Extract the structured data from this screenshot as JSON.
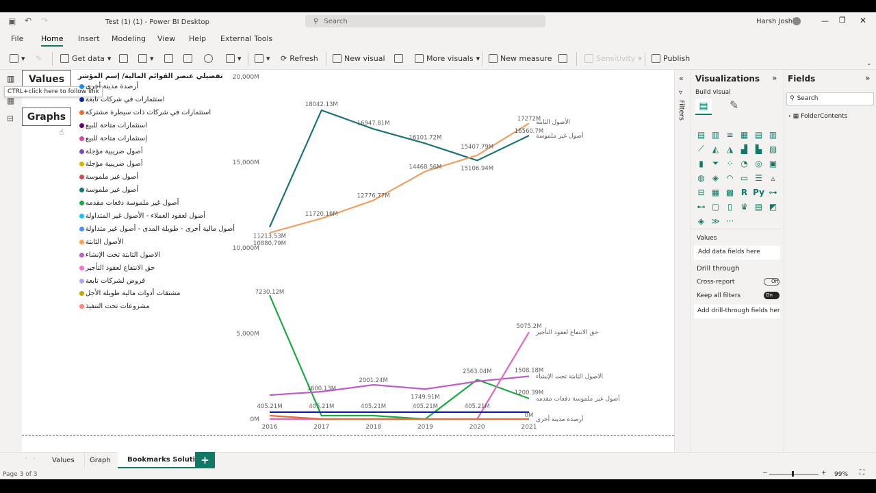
{
  "window": {
    "title": "Test (1) (1) - Power BI Desktop",
    "search_placeholder": "Search",
    "user": "Harsh Joshi"
  },
  "menu": [
    "File",
    "Home",
    "Insert",
    "Modeling",
    "View",
    "Help",
    "External Tools"
  ],
  "ribbon": {
    "get_data": "Get data",
    "refresh": "Refresh",
    "new_visual": "New visual",
    "more_visuals": "More visuals",
    "new_measure": "New measure",
    "sensitivity": "Sensitivity",
    "publish": "Publish"
  },
  "bookmarks": {
    "values": "Values",
    "graphs": "Graphs",
    "tooltip": "CTRL+click here to follow link"
  },
  "legend": {
    "title": "تفصيلي عنصر القوائم المالية/ إسم المؤشر",
    "items": [
      {
        "label": "أرصدة مدينة أخرى",
        "color": "#118dff"
      },
      {
        "label": "استثمارات في شركات تابعة",
        "color": "#12239e"
      },
      {
        "label": "استثمارات في شركات ذات سيطرة مشتركة",
        "color": "#e66c37"
      },
      {
        "label": "استثمارات متاحة للبيع",
        "color": "#6b007b"
      },
      {
        "label": "إستثمارات متاحة للبيع",
        "color": "#e044a7"
      },
      {
        "label": "أصول ضريبية مؤجلة",
        "color": "#744ec2"
      },
      {
        "label": "أصول ضريبية مؤجلة",
        "color": "#d9b300"
      },
      {
        "label": "أصول غير ملموسة",
        "color": "#d64550"
      },
      {
        "label": "أصول غير ملموسة",
        "color": "#197278"
      },
      {
        "label": "أصول غير ملموسة دفعات مقدمه",
        "color": "#1aab40"
      },
      {
        "label": "أصول لعقود العملاء - الأصول غير المتداولة",
        "color": "#15c6f4"
      },
      {
        "label": "أصول مالية أخرى - طويلة المدى - أصول غير متداولة",
        "color": "#4092ff"
      },
      {
        "label": "الأصول الثابتة",
        "color": "#ffa058"
      },
      {
        "label": "الاصول الثابتة تحت الإنشاء",
        "color": "#be5dc9"
      },
      {
        "label": "حق الانتفاع لعقود التأجير",
        "color": "#f472d0"
      },
      {
        "label": "قروض لشركات تابعة",
        "color": "#b5a1ff"
      },
      {
        "label": "مشتقات أدوات مالية طويلة الأجل",
        "color": "#c4a200"
      },
      {
        "label": "مشروعات تحت التنفيذ",
        "color": "#ff8080"
      }
    ]
  },
  "chart_data": {
    "type": "line",
    "x": [
      "2016",
      "2017",
      "2018",
      "2019",
      "2020",
      "2021"
    ],
    "ylim": [
      0,
      20000
    ],
    "yticks": [
      "0M",
      "5,000M",
      "10,000M",
      "15,000M",
      "20,000M"
    ],
    "series": [
      {
        "name": "أصول غير ملموسة",
        "color": "#197278",
        "values": [
          11213.53,
          18042.13,
          16947.81,
          16101.72,
          15106.94,
          16560
        ]
      },
      {
        "name": "الأصول الثابتة",
        "color": "#f0a060",
        "values": [
          10880.79,
          11720.16,
          12776.77,
          14468.56,
          15407.79,
          17272
        ]
      },
      {
        "name": "أصول غير ملموسة دفعات مقدمه",
        "color": "#1aab40",
        "values": [
          7230.12,
          200,
          200,
          0,
          2300,
          1200.39
        ]
      },
      {
        "name": "الاصول الثابتة تحت الإنشاء",
        "color": "#be5dc9",
        "values": [
          1400,
          1600,
          2000,
          1750,
          2200,
          2500
        ]
      },
      {
        "name": "حق الانتفاع لعقود التأجير",
        "color": "#e066c0",
        "values": [
          0,
          0,
          0,
          0,
          0,
          5075.2
        ]
      },
      {
        "name": "أرصدة مدينة أخرى",
        "color": "#12239e",
        "values": [
          405.21,
          405.21,
          405.21,
          405.21,
          405.21,
          405.21
        ]
      },
      {
        "name": "مشروعات تحت التنفيذ",
        "color": "#e66c37",
        "values": [
          200,
          0,
          0,
          0,
          0,
          0
        ]
      }
    ],
    "labels": [
      {
        "t": "18042.13M",
        "x": 2017,
        "y": 18042.13,
        "dy": -6
      },
      {
        "t": "16947.81M",
        "x": 2018,
        "y": 16947.81,
        "dy": -6
      },
      {
        "t": "16101.72M",
        "x": 2019,
        "y": 16101.72,
        "dy": -6
      },
      {
        "t": "15407.79M",
        "x": 2020,
        "y": 15407.79,
        "dy": -10
      },
      {
        "t": "15106.94M",
        "x": 2020,
        "y": 15106.94,
        "dy": 14
      },
      {
        "t": "17272M",
        "x": 2021,
        "y": 17272,
        "dy": -4
      },
      {
        "t": "16560.7M",
        "x": 2021,
        "y": 16560,
        "dy": -4
      },
      {
        "t": "11213.53M",
        "x": 2016,
        "y": 11213.53,
        "dy": 16
      },
      {
        "t": "10880.79M",
        "x": 2016,
        "y": 10880.79,
        "dy": 18
      },
      {
        "t": "11720.16M",
        "x": 2017,
        "y": 11720.16,
        "dy": -4
      },
      {
        "t": "12776.77M",
        "x": 2018,
        "y": 12776.77,
        "dy": -4
      },
      {
        "t": "14468.56M",
        "x": 2019,
        "y": 14468.56,
        "dy": -4
      },
      {
        "t": "7230.12M",
        "x": 2016,
        "y": 7230.12,
        "dy": -2
      },
      {
        "t": "5075.2M",
        "x": 2021,
        "y": 5075.2,
        "dy": -6
      },
      {
        "t": "2001.24M",
        "x": 2018,
        "y": 2000,
        "dy": -4
      },
      {
        "t": "1600.13M",
        "x": 2017,
        "y": 1600,
        "dy": -2
      },
      {
        "t": "2563.04M",
        "x": 2020,
        "y": 2200,
        "dy": -12
      },
      {
        "t": "1508.18M",
        "x": 2021,
        "y": 2500,
        "dy": -6
      },
      {
        "t": "1749.91M",
        "x": 2019,
        "y": 1750,
        "dy": 14
      },
      {
        "t": "1200.39M",
        "x": 2021,
        "y": 1200.39,
        "dy": -6
      },
      {
        "t": "405.21M",
        "x": 2016,
        "y": 405.21,
        "dy": -6
      },
      {
        "t": "405.21M",
        "x": 2017,
        "y": 405.21,
        "dy": -6
      },
      {
        "t": "405.21M",
        "x": 2018,
        "y": 405.21,
        "dy": -6
      },
      {
        "t": "405.21M",
        "x": 2019,
        "y": 405.21,
        "dy": -6
      },
      {
        "t": "405.21M",
        "x": 2020,
        "y": 405.21,
        "dy": -6
      },
      {
        "t": "0M",
        "x": 2021,
        "y": 0,
        "dy": -3
      }
    ],
    "end_labels": [
      {
        "t": "الأصول الثابتة",
        "y": 17272,
        "dy": -2
      },
      {
        "t": "أصول غير ملموسة",
        "y": 16560,
        "dy": 0
      },
      {
        "t": "حق الانتفاع لعقود التأجير",
        "y": 5075.2,
        "dy": 0
      },
      {
        "t": "الاصول الثابتة تحت الإنشاء",
        "y": 2500,
        "dy": 0
      },
      {
        "t": "أصول غير ملموسة دفعات مقدمه",
        "y": 1200.39,
        "dy": 0
      },
      {
        "t": "أرصدة مدينة أخرى",
        "y": 0,
        "dy": 0
      }
    ]
  },
  "viz": {
    "title": "Visualizations",
    "build": "Build visual",
    "values": "Values",
    "add_data": "Add data fields here",
    "drill": "Drill through",
    "cross": "Cross-report",
    "cross_state": "Off",
    "keep": "Keep all filters",
    "keep_state": "On",
    "add_drill": "Add drill-through fields here"
  },
  "fields": {
    "title": "Fields",
    "search": "Search",
    "item": "FolderContents"
  },
  "filters": "Filters",
  "pages": [
    "Values",
    "Graph",
    "Bookmarks Solution"
  ],
  "status": {
    "page": "Page 3 of 3",
    "zoom": "99%"
  }
}
